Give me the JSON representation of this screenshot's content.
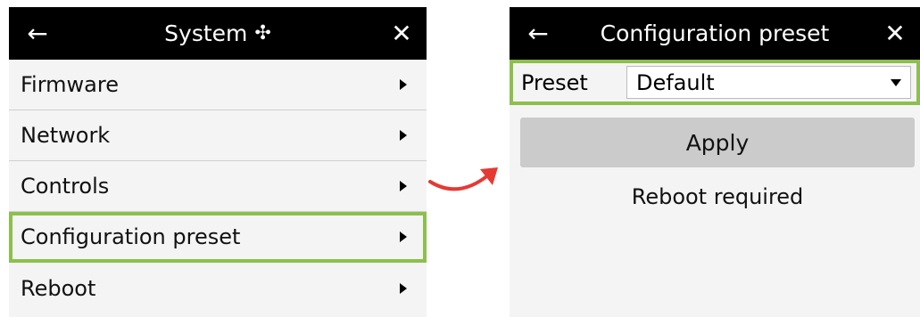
{
  "colors": {
    "highlight": "#8cc04b",
    "arrow": "#e53935",
    "titlebar": "#000000"
  },
  "left": {
    "title": "System",
    "title_icon": "✣",
    "back_icon": "←",
    "close_icon": "✕",
    "items": [
      {
        "label": "Firmware"
      },
      {
        "label": "Network"
      },
      {
        "label": "Controls"
      },
      {
        "label": "Configuration preset",
        "highlighted": true
      },
      {
        "label": "Reboot"
      }
    ]
  },
  "right": {
    "title": "Configuration preset",
    "back_icon": "←",
    "close_icon": "✕",
    "preset_label": "Preset",
    "preset_value": "Default",
    "apply_label": "Apply",
    "status": "Reboot required"
  }
}
